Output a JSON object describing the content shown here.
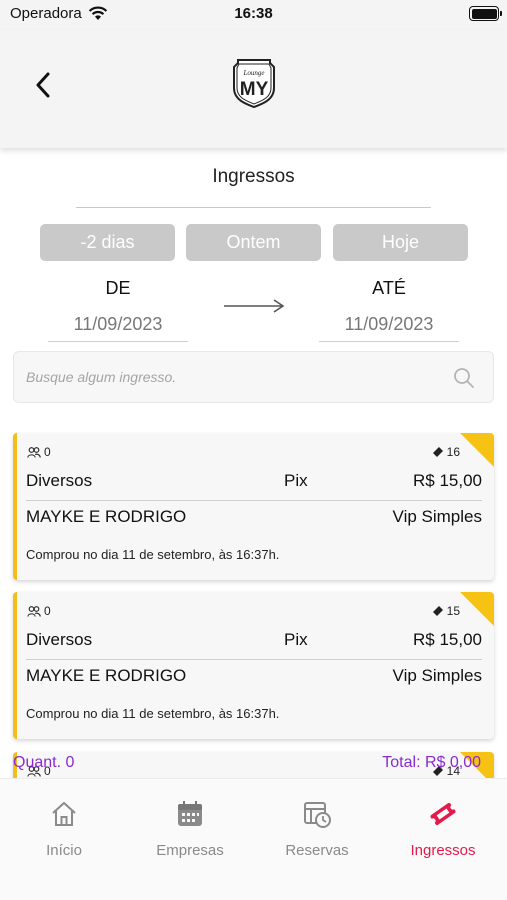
{
  "status_bar": {
    "carrier": "Operadora",
    "time": "16:38"
  },
  "header": {
    "logo_text_small": "Lounge",
    "logo_text": "MY"
  },
  "page": {
    "title": "Ingressos"
  },
  "quick_filters": [
    "-2 dias",
    "Ontem",
    "Hoje"
  ],
  "date_range": {
    "from_label": "DE",
    "from_value": "11/09/2023",
    "to_label": "ATÉ",
    "to_value": "11/09/2023"
  },
  "search": {
    "placeholder": "Busque algum ingresso."
  },
  "tickets": [
    {
      "people": "0",
      "ticket_count": "16",
      "category": "Diversos",
      "payment": "Pix",
      "price": "R$ 15,00",
      "name": "MAYKE E RODRIGO",
      "type": "Vip Simples",
      "purchase_info": "Comprou no dia 11 de setembro, às 16:37h."
    },
    {
      "people": "0",
      "ticket_count": "15",
      "category": "Diversos",
      "payment": "Pix",
      "price": "R$ 15,00",
      "name": "MAYKE E RODRIGO",
      "type": "Vip Simples",
      "purchase_info": "Comprou no dia 11 de setembro, às 16:37h."
    },
    {
      "people": "0",
      "ticket_count": "14"
    }
  ],
  "summary": {
    "quantity": "Quant. 0",
    "total": "Total: R$ 0,00"
  },
  "tabbar": {
    "items": [
      {
        "label": "Início",
        "icon": "home-icon"
      },
      {
        "label": "Empresas",
        "icon": "calendar-icon"
      },
      {
        "label": "Reservas",
        "icon": "reservation-clock-icon"
      },
      {
        "label": "Ingressos",
        "icon": "ticket-icon"
      }
    ],
    "active": "Ingressos"
  },
  "colors": {
    "accent_yellow": "#f2be1a",
    "active_tab": "#e21b4c",
    "summary_purple": "#8a2bd0",
    "quick_button": "#c9c9c9"
  }
}
